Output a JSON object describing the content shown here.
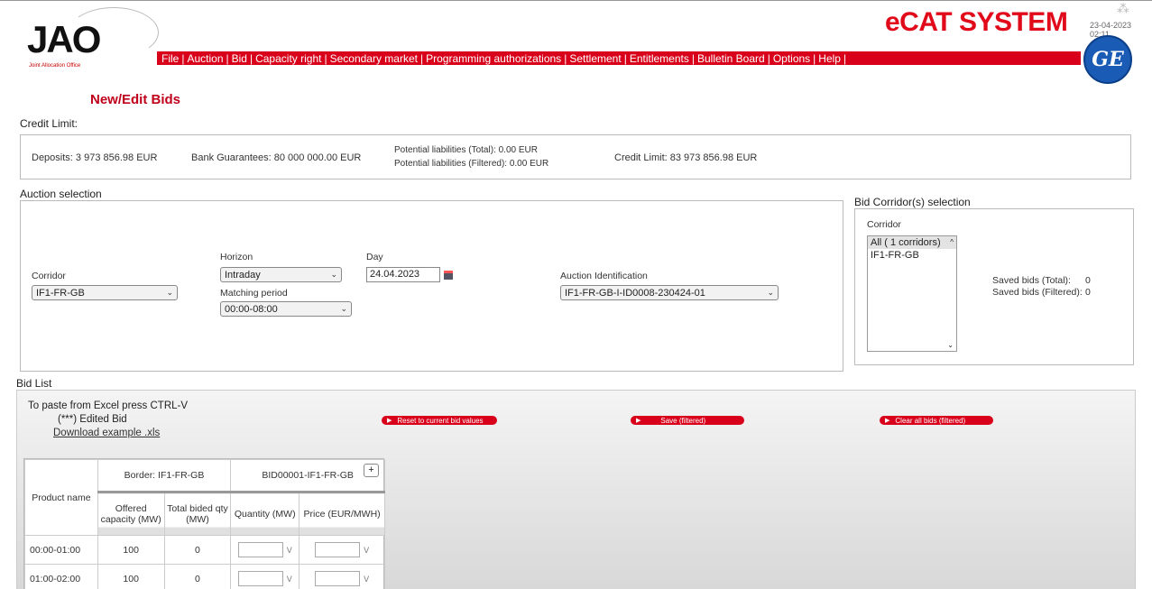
{
  "header": {
    "logo_text": "JAO",
    "logo_sub": "Joint Allocation Office",
    "app_title": "eCAT SYSTEM",
    "timestamp": "23-04-2023 02:11",
    "ge_logo": "GE"
  },
  "menu": [
    "File",
    "Auction",
    "Bid",
    "Capacity right",
    "Secondary market",
    "Programming authorizations",
    "Settlement",
    "Entitlements",
    "Bulletin Board",
    "Options",
    "Help"
  ],
  "page_title": "New/Edit Bids",
  "credit": {
    "section_label": "Credit Limit:",
    "deposits": "Deposits: 3 973 856.98 EUR",
    "bank_guarantees": "Bank Guarantees: 80 000 000.00 EUR",
    "potential_total": "Potential liabilities (Total): 0.00 EUR",
    "potential_filtered": "Potential liabilities (Filtered): 0.00 EUR",
    "credit_limit": "Credit Limit: 83 973 856.98 EUR"
  },
  "auction": {
    "section_label": "Auction selection",
    "corridor_label": "Corridor",
    "corridor_value": "IF1-FR-GB",
    "horizon_label": "Horizon",
    "horizon_value": "Intraday",
    "matching_label": "Matching period",
    "matching_value": "00:00-08:00",
    "day_label": "Day",
    "day_value": "24.04.2023",
    "auction_id_label": "Auction Identification",
    "auction_id_value": "IF1-FR-GB-I-ID0008-230424-01"
  },
  "corridor_selection": {
    "section_label": "Bid Corridor(s) selection",
    "corridor_label": "Corridor",
    "options": [
      "All ( 1 corridors)",
      "IF1-FR-GB"
    ],
    "saved_total_label": "Saved bids (Total):",
    "saved_total_value": "0",
    "saved_filtered_label": "Saved bids (Filtered):",
    "saved_filtered_value": "0"
  },
  "bidlist": {
    "section_label": "Bid List",
    "paste_hint": "To paste from Excel press CTRL-V",
    "edited_hint": "(***) Edited Bid",
    "download_link": "Download example .xls",
    "reset_button": "Reset to current bid values",
    "save_button": "Save (filtered)",
    "clear_button": "Clear all bids (filtered)",
    "grid": {
      "product_header": "Product name",
      "border_header": "Border: IF1-FR-GB",
      "bid_header": "BID00001-IF1-FR-GB",
      "offered_header": "Offered capacity (MW)",
      "total_header": "Total bided qty (MW)",
      "quantity_header": "Quantity (MW)",
      "price_header": "Price (EUR/MWH)",
      "input_suffix": "V",
      "plus": "+",
      "rows": [
        {
          "product": "00:00-01:00",
          "offered": "100",
          "total": "0"
        },
        {
          "product": "01:00-02:00",
          "offered": "100",
          "total": "0"
        }
      ]
    }
  }
}
